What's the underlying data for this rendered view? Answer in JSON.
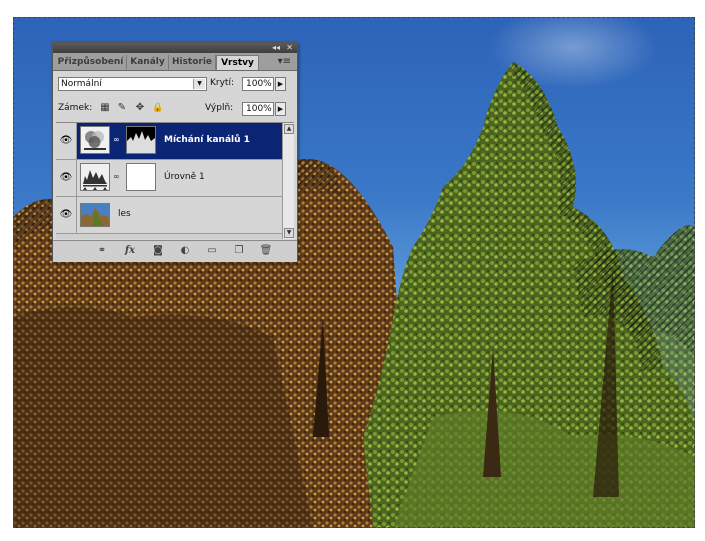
{
  "panel": {
    "tabs": [
      {
        "label": "Přizpůsobení",
        "active": false
      },
      {
        "label": "Kanály",
        "active": false
      },
      {
        "label": "Historie",
        "active": false
      },
      {
        "label": "Vrstvy",
        "active": true
      }
    ],
    "blend_mode": "Normální",
    "opacity_label": "Krytí:",
    "opacity_value": "100%",
    "lock_label": "Zámek:",
    "fill_label": "Výplň:",
    "fill_value": "100%",
    "layers": [
      {
        "name": "Míchání kanálů 1",
        "selected": true,
        "visible": true,
        "type": "channel-mixer-adjustment"
      },
      {
        "name": "Úrovně 1",
        "selected": false,
        "visible": true,
        "type": "levels-adjustment"
      },
      {
        "name": "les",
        "selected": false,
        "visible": true,
        "type": "image"
      }
    ],
    "icons": {
      "eye": "👁",
      "chain": "∞",
      "collapse": "◂◂",
      "close": "✕",
      "menu": "▾≡",
      "dropdown": "▼",
      "arrow_right": "▶",
      "scroll_up": "▲",
      "scroll_down": "▼",
      "lock_transparent": "▦",
      "lock_paint": "✎",
      "lock_move": "✥",
      "lock_all": "🔒",
      "link_layers": "⚭",
      "fx": "fx",
      "mask": "◙",
      "adjustment": "◐",
      "group": "▭",
      "new_layer": "❐",
      "trash": "🗑"
    }
  },
  "colors": {
    "selected_layer": "#0b2474",
    "sky": "#3a78c8",
    "panel_bg": "#d6d6d6"
  }
}
